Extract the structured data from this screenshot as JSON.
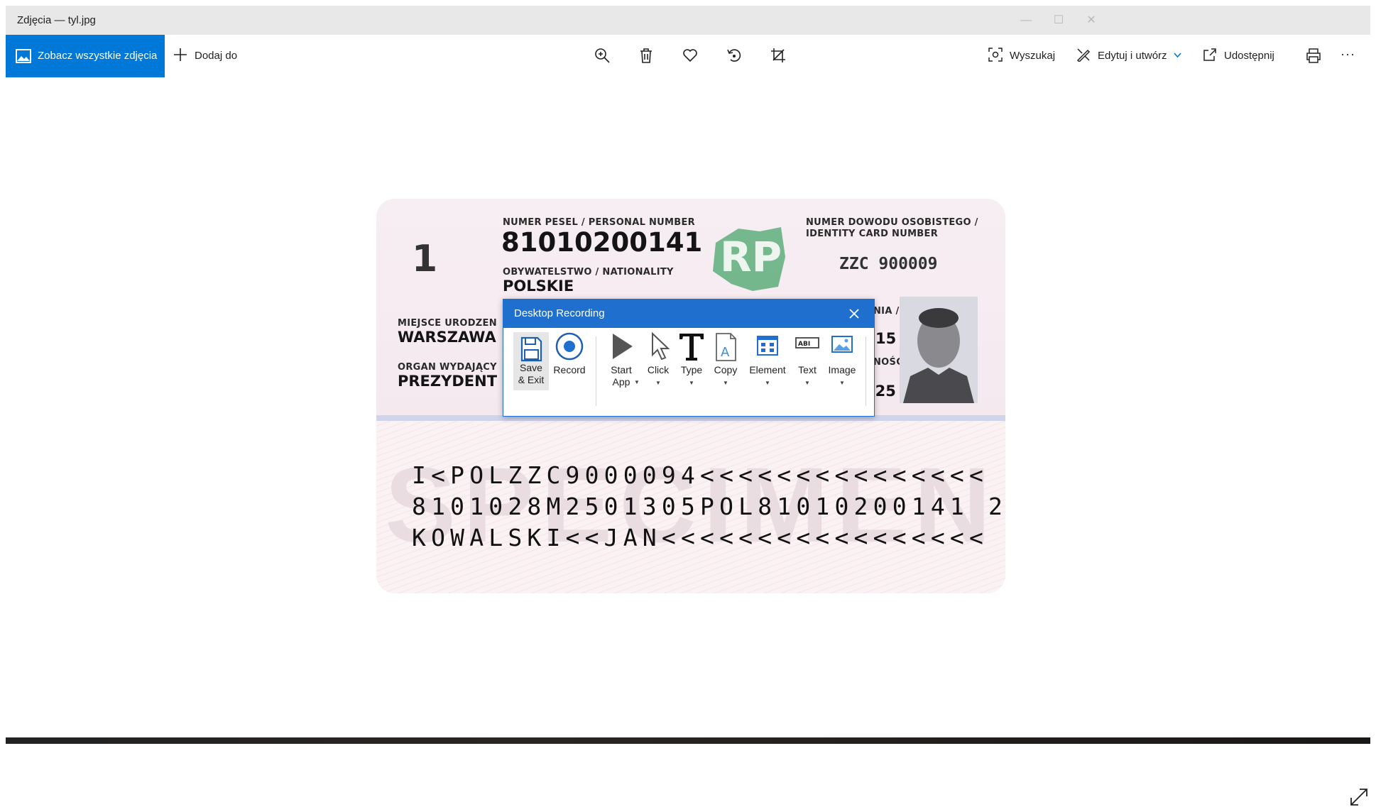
{
  "window": {
    "title": "Zdjęcia — tyl.jpg",
    "controls": {
      "minimize": "—",
      "maximize": "☐",
      "close": "✕"
    }
  },
  "toolbar": {
    "see_all_label": "Zobacz wszystkie zdjęcia",
    "add_to_label": "Dodaj do",
    "center_icons": [
      "zoom-in-icon",
      "trash-icon",
      "heart-icon",
      "rotate-icon",
      "crop-icon"
    ],
    "search_label": "Wyszukaj",
    "edit_create_label": "Edytuj i utwórz",
    "share_label": "Udostępnij",
    "print_icon": "printer-icon",
    "more_label": "···"
  },
  "id_card": {
    "pesel_label": "NUMER PESEL / PERSONAL NUMBER",
    "pesel_value": "81010200141",
    "id_number_label": "NUMER DOWODU OSOBISTEGO /",
    "id_number_label2": "IDENTITY CARD NUMBER",
    "id_number_value": "ZZC 900009",
    "nationality_label": "OBYWATELSTWO / NATIONALITY",
    "nationality_value": "POLSKIE",
    "birthplace_label": "MIEJSCE URODZEN",
    "birthplace_value": "WARSZAWA",
    "issuer_label": "ORGAN WYDAJĄCY",
    "issuer_value": "PREZYDENT",
    "partial_label_1": "NIA /",
    "partial_value_1": "15",
    "partial_label_2": "NOŚCI /",
    "partial_value_2": "025",
    "can_code": "1",
    "emblem_text": "RP",
    "watermark": "SPECIMEN",
    "mrz_line1": "I<POLZZC9000094<<<<<<<<<<<<<<<",
    "mrz_line2": "8101028M2501305POL81010200141 2",
    "mrz_line3": "KOWALSKI<<JAN<<<<<<<<<<<<<<<<<"
  },
  "recording_dialog": {
    "title": "Desktop Recording",
    "items": [
      {
        "label": "Save & Exit",
        "line1": "Save",
        "line2": "& Exit",
        "icon": "floppy-disk-icon"
      },
      {
        "label": "Record",
        "icon": "record-icon"
      },
      {
        "label": "Start App",
        "line1": "Start",
        "line2": "App",
        "icon": "play-icon"
      },
      {
        "label": "Click",
        "icon": "cursor-icon"
      },
      {
        "label": "Type",
        "icon": "text-t-icon"
      },
      {
        "label": "Copy",
        "icon": "copy-document-icon"
      },
      {
        "label": "Element",
        "icon": "element-grid-icon"
      },
      {
        "label": "Text",
        "icon": "text-field-icon"
      },
      {
        "label": "Image",
        "icon": "picture-icon"
      }
    ]
  },
  "colors": {
    "accent": "#0078d7",
    "dialog_header": "#1e6fce",
    "titlebar": "#e8e8e8"
  }
}
